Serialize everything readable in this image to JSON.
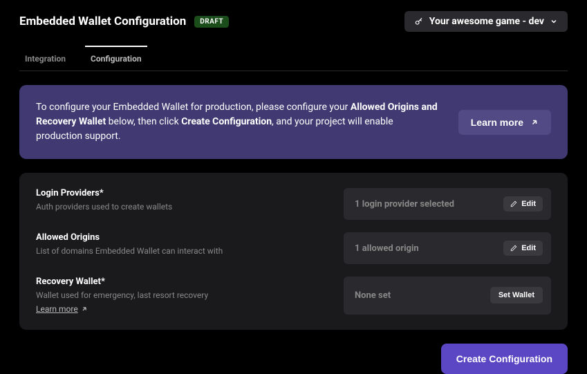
{
  "header": {
    "title": "Embedded Wallet Configuration",
    "badge": "DRAFT",
    "project": "Your awesome game - dev"
  },
  "tabs": {
    "integration": "Integration",
    "configuration": "Configuration"
  },
  "banner": {
    "text_1": "To configure your Embedded Wallet for production, please configure your ",
    "strong_1": "Allowed Origins and Recovery Wallet",
    "text_2": " below, then click ",
    "strong_2": "Create Configuration",
    "text_3": ", and your project will enable production support.",
    "learn_more": "Learn more"
  },
  "config": {
    "login_providers": {
      "label": "Login Providers*",
      "desc": "Auth providers used to create wallets",
      "value": "1 login provider selected",
      "edit": "Edit"
    },
    "allowed_origins": {
      "label": "Allowed Origins",
      "desc": "List of domains Embedded Wallet can interact with",
      "value": "1 allowed origin",
      "edit": "Edit"
    },
    "recovery_wallet": {
      "label": "Recovery Wallet*",
      "desc": "Wallet used for emergency, last resort recovery",
      "learn_more": "Learn more",
      "value": "None set",
      "set_wallet": "Set Wallet"
    }
  },
  "footer": {
    "create": "Create Configuration"
  }
}
